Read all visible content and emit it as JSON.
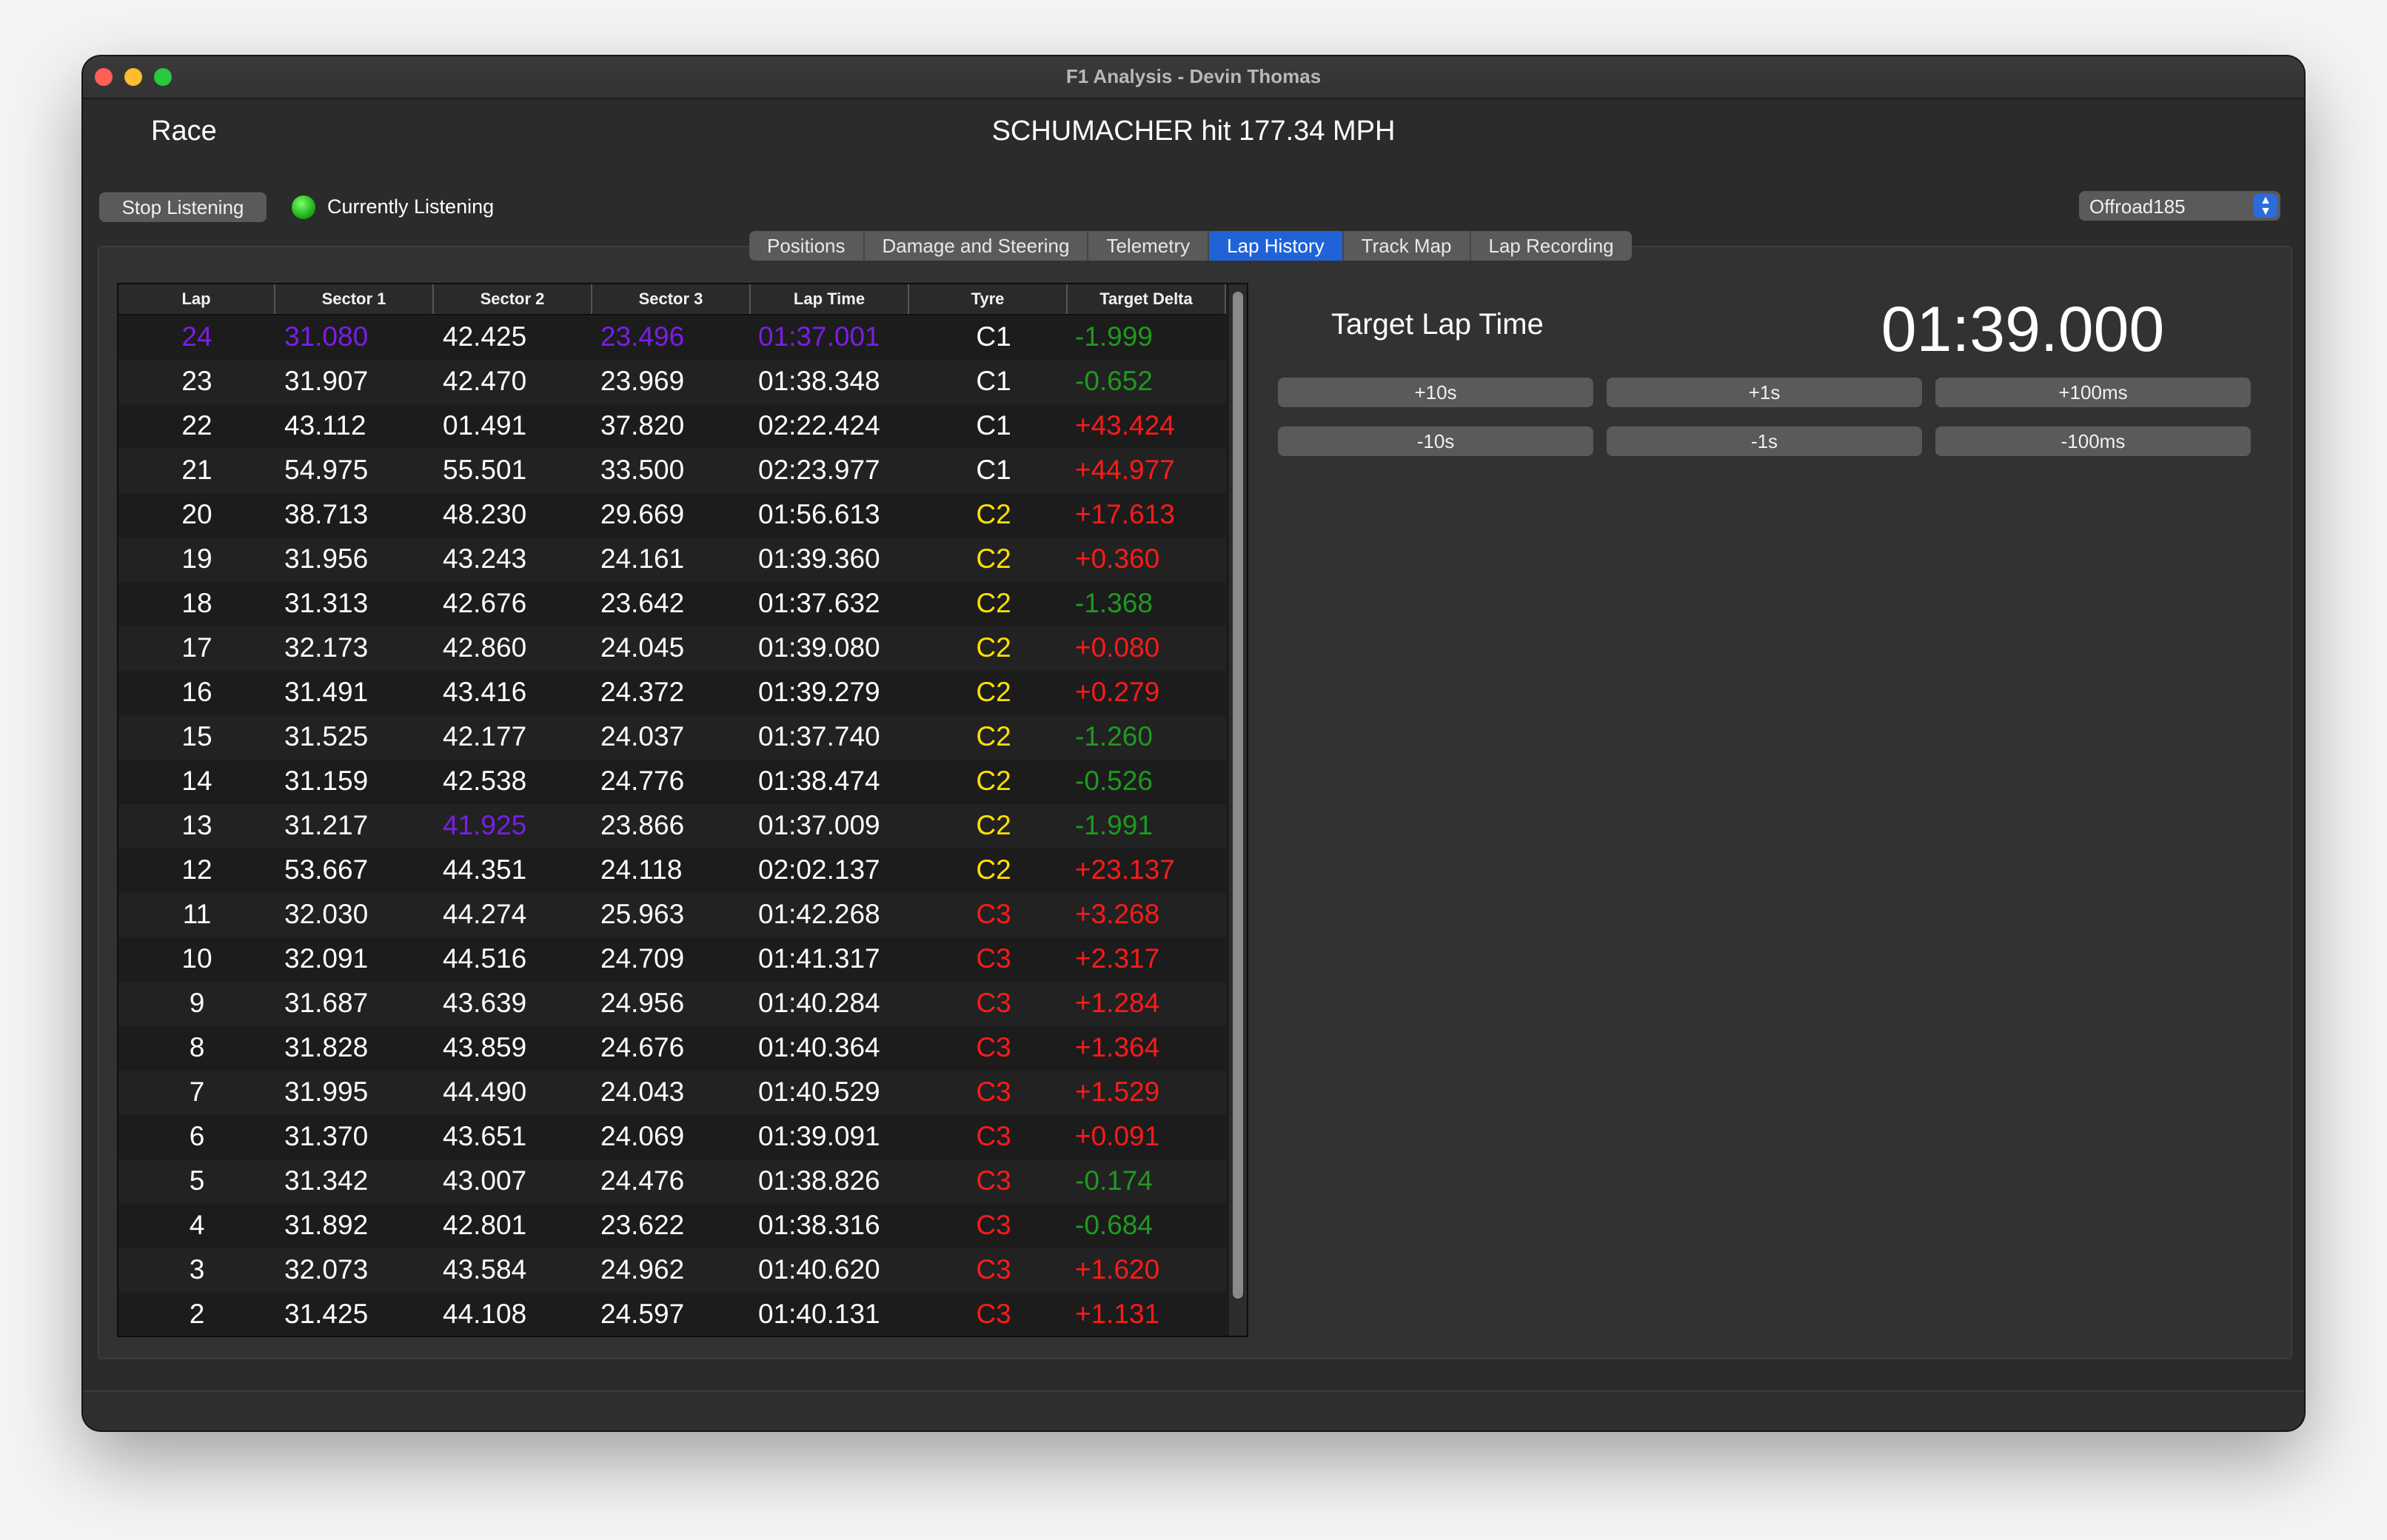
{
  "window": {
    "title": "F1 Analysis - Devin Thomas"
  },
  "header": {
    "session": "Race",
    "speed_message": "SCHUMACHER hit 177.34 MPH"
  },
  "controls": {
    "stop_label": "Stop Listening",
    "status_label": "Currently Listening",
    "status_color": "#1fb21a",
    "dropdown_value": "Offroad185",
    "dropdown_arrows": "⌃⌄"
  },
  "tabs": [
    "Positions",
    "Damage and Steering",
    "Telemetry",
    "Lap History",
    "Track Map",
    "Lap Recording"
  ],
  "active_tab": "Lap History",
  "colors": {
    "purple": "#7a1ee6",
    "green": "#1f9a1f",
    "red": "#ff1a1a",
    "yellow": "#ffe000",
    "white": "#ffffff"
  },
  "table": {
    "columns": [
      "Lap",
      "Sector 1",
      "Sector 2",
      "Sector 3",
      "Lap Time",
      "Tyre",
      "Target Delta"
    ],
    "rows": [
      {
        "lap": "24",
        "s1": "31.080",
        "s2": "42.425",
        "s3": "23.496",
        "lt": "01:37.001",
        "tyre": "C1",
        "delta": "-1.999",
        "fast": [
          "lap",
          "s1",
          "s3",
          "lt"
        ]
      },
      {
        "lap": "23",
        "s1": "31.907",
        "s2": "42.470",
        "s3": "23.969",
        "lt": "01:38.348",
        "tyre": "C1",
        "delta": "-0.652",
        "fast": []
      },
      {
        "lap": "22",
        "s1": "43.112",
        "s2": "01.491",
        "s3": "37.820",
        "lt": "02:22.424",
        "tyre": "C1",
        "delta": "+43.424",
        "fast": []
      },
      {
        "lap": "21",
        "s1": "54.975",
        "s2": "55.501",
        "s3": "33.500",
        "lt": "02:23.977",
        "tyre": "C1",
        "delta": "+44.977",
        "fast": []
      },
      {
        "lap": "20",
        "s1": "38.713",
        "s2": "48.230",
        "s3": "29.669",
        "lt": "01:56.613",
        "tyre": "C2",
        "delta": "+17.613",
        "fast": []
      },
      {
        "lap": "19",
        "s1": "31.956",
        "s2": "43.243",
        "s3": "24.161",
        "lt": "01:39.360",
        "tyre": "C2",
        "delta": "+0.360",
        "fast": []
      },
      {
        "lap": "18",
        "s1": "31.313",
        "s2": "42.676",
        "s3": "23.642",
        "lt": "01:37.632",
        "tyre": "C2",
        "delta": "-1.368",
        "fast": []
      },
      {
        "lap": "17",
        "s1": "32.173",
        "s2": "42.860",
        "s3": "24.045",
        "lt": "01:39.080",
        "tyre": "C2",
        "delta": "+0.080",
        "fast": []
      },
      {
        "lap": "16",
        "s1": "31.491",
        "s2": "43.416",
        "s3": "24.372",
        "lt": "01:39.279",
        "tyre": "C2",
        "delta": "+0.279",
        "fast": []
      },
      {
        "lap": "15",
        "s1": "31.525",
        "s2": "42.177",
        "s3": "24.037",
        "lt": "01:37.740",
        "tyre": "C2",
        "delta": "-1.260",
        "fast": []
      },
      {
        "lap": "14",
        "s1": "31.159",
        "s2": "42.538",
        "s3": "24.776",
        "lt": "01:38.474",
        "tyre": "C2",
        "delta": "-0.526",
        "fast": []
      },
      {
        "lap": "13",
        "s1": "31.217",
        "s2": "41.925",
        "s3": "23.866",
        "lt": "01:37.009",
        "tyre": "C2",
        "delta": "-1.991",
        "fast": [
          "s2"
        ]
      },
      {
        "lap": "12",
        "s1": "53.667",
        "s2": "44.351",
        "s3": "24.118",
        "lt": "02:02.137",
        "tyre": "C2",
        "delta": "+23.137",
        "fast": []
      },
      {
        "lap": "11",
        "s1": "32.030",
        "s2": "44.274",
        "s3": "25.963",
        "lt": "01:42.268",
        "tyre": "C3",
        "delta": "+3.268",
        "fast": []
      },
      {
        "lap": "10",
        "s1": "32.091",
        "s2": "44.516",
        "s3": "24.709",
        "lt": "01:41.317",
        "tyre": "C3",
        "delta": "+2.317",
        "fast": []
      },
      {
        "lap": "9",
        "s1": "31.687",
        "s2": "43.639",
        "s3": "24.956",
        "lt": "01:40.284",
        "tyre": "C3",
        "delta": "+1.284",
        "fast": []
      },
      {
        "lap": "8",
        "s1": "31.828",
        "s2": "43.859",
        "s3": "24.676",
        "lt": "01:40.364",
        "tyre": "C3",
        "delta": "+1.364",
        "fast": []
      },
      {
        "lap": "7",
        "s1": "31.995",
        "s2": "44.490",
        "s3": "24.043",
        "lt": "01:40.529",
        "tyre": "C3",
        "delta": "+1.529",
        "fast": []
      },
      {
        "lap": "6",
        "s1": "31.370",
        "s2": "43.651",
        "s3": "24.069",
        "lt": "01:39.091",
        "tyre": "C3",
        "delta": "+0.091",
        "fast": []
      },
      {
        "lap": "5",
        "s1": "31.342",
        "s2": "43.007",
        "s3": "24.476",
        "lt": "01:38.826",
        "tyre": "C3",
        "delta": "-0.174",
        "fast": []
      },
      {
        "lap": "4",
        "s1": "31.892",
        "s2": "42.801",
        "s3": "23.622",
        "lt": "01:38.316",
        "tyre": "C3",
        "delta": "-0.684",
        "fast": []
      },
      {
        "lap": "3",
        "s1": "32.073",
        "s2": "43.584",
        "s3": "24.962",
        "lt": "01:40.620",
        "tyre": "C3",
        "delta": "+1.620",
        "fast": []
      },
      {
        "lap": "2",
        "s1": "31.425",
        "s2": "44.108",
        "s3": "24.597",
        "lt": "01:40.131",
        "tyre": "C3",
        "delta": "+1.131",
        "fast": []
      }
    ]
  },
  "target": {
    "label": "Target Lap Time",
    "value": "01:39.000",
    "buttons": [
      "+10s",
      "+1s",
      "+100ms",
      "-10s",
      "-1s",
      "-100ms"
    ]
  }
}
